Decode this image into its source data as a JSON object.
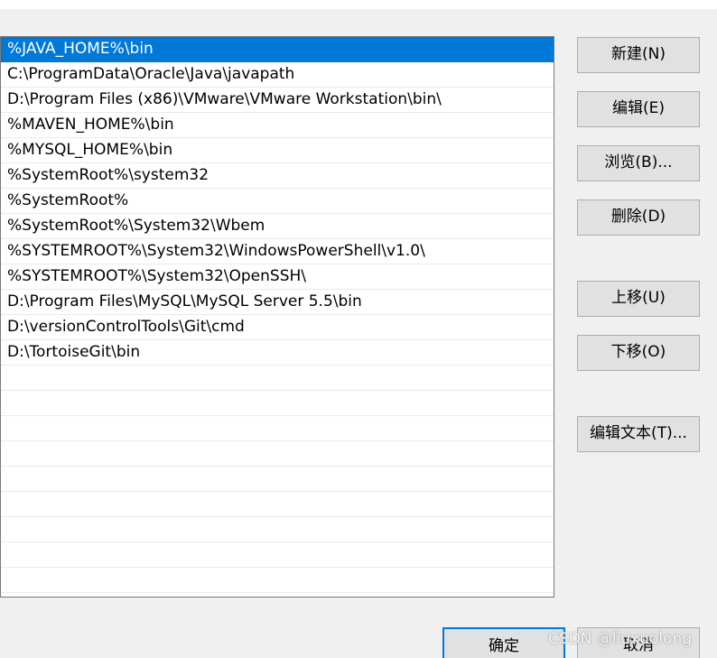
{
  "path_list": {
    "items": [
      {
        "label": "%JAVA_HOME%\\bin",
        "selected": true
      },
      {
        "label": "C:\\ProgramData\\Oracle\\Java\\javapath",
        "selected": false
      },
      {
        "label": "D:\\Program Files (x86)\\VMware\\VMware Workstation\\bin\\",
        "selected": false
      },
      {
        "label": "%MAVEN_HOME%\\bin",
        "selected": false
      },
      {
        "label": "%MYSQL_HOME%\\bin",
        "selected": false
      },
      {
        "label": "%SystemRoot%\\system32",
        "selected": false
      },
      {
        "label": "%SystemRoot%",
        "selected": false
      },
      {
        "label": "%SystemRoot%\\System32\\Wbem",
        "selected": false
      },
      {
        "label": "%SYSTEMROOT%\\System32\\WindowsPowerShell\\v1.0\\",
        "selected": false
      },
      {
        "label": "%SYSTEMROOT%\\System32\\OpenSSH\\",
        "selected": false
      },
      {
        "label": "D:\\Program Files\\MySQL\\MySQL Server 5.5\\bin",
        "selected": false
      },
      {
        "label": "D:\\versionControlTools\\Git\\cmd",
        "selected": false
      },
      {
        "label": "D:\\TortoiseGit\\bin",
        "selected": false
      }
    ]
  },
  "buttons": {
    "new": "新建(N)",
    "edit": "编辑(E)",
    "browse": "浏览(B)...",
    "delete": "删除(D)",
    "move_up": "上移(U)",
    "move_down": "下移(O)",
    "edit_text": "编辑文本(T)...",
    "ok": "确定",
    "cancel": "取消"
  },
  "watermark": "CSDN @liuxuolong",
  "colors": {
    "selection": "#0078d7",
    "dialog_background": "#f0f0f0",
    "button_face": "#e1e1e1"
  }
}
